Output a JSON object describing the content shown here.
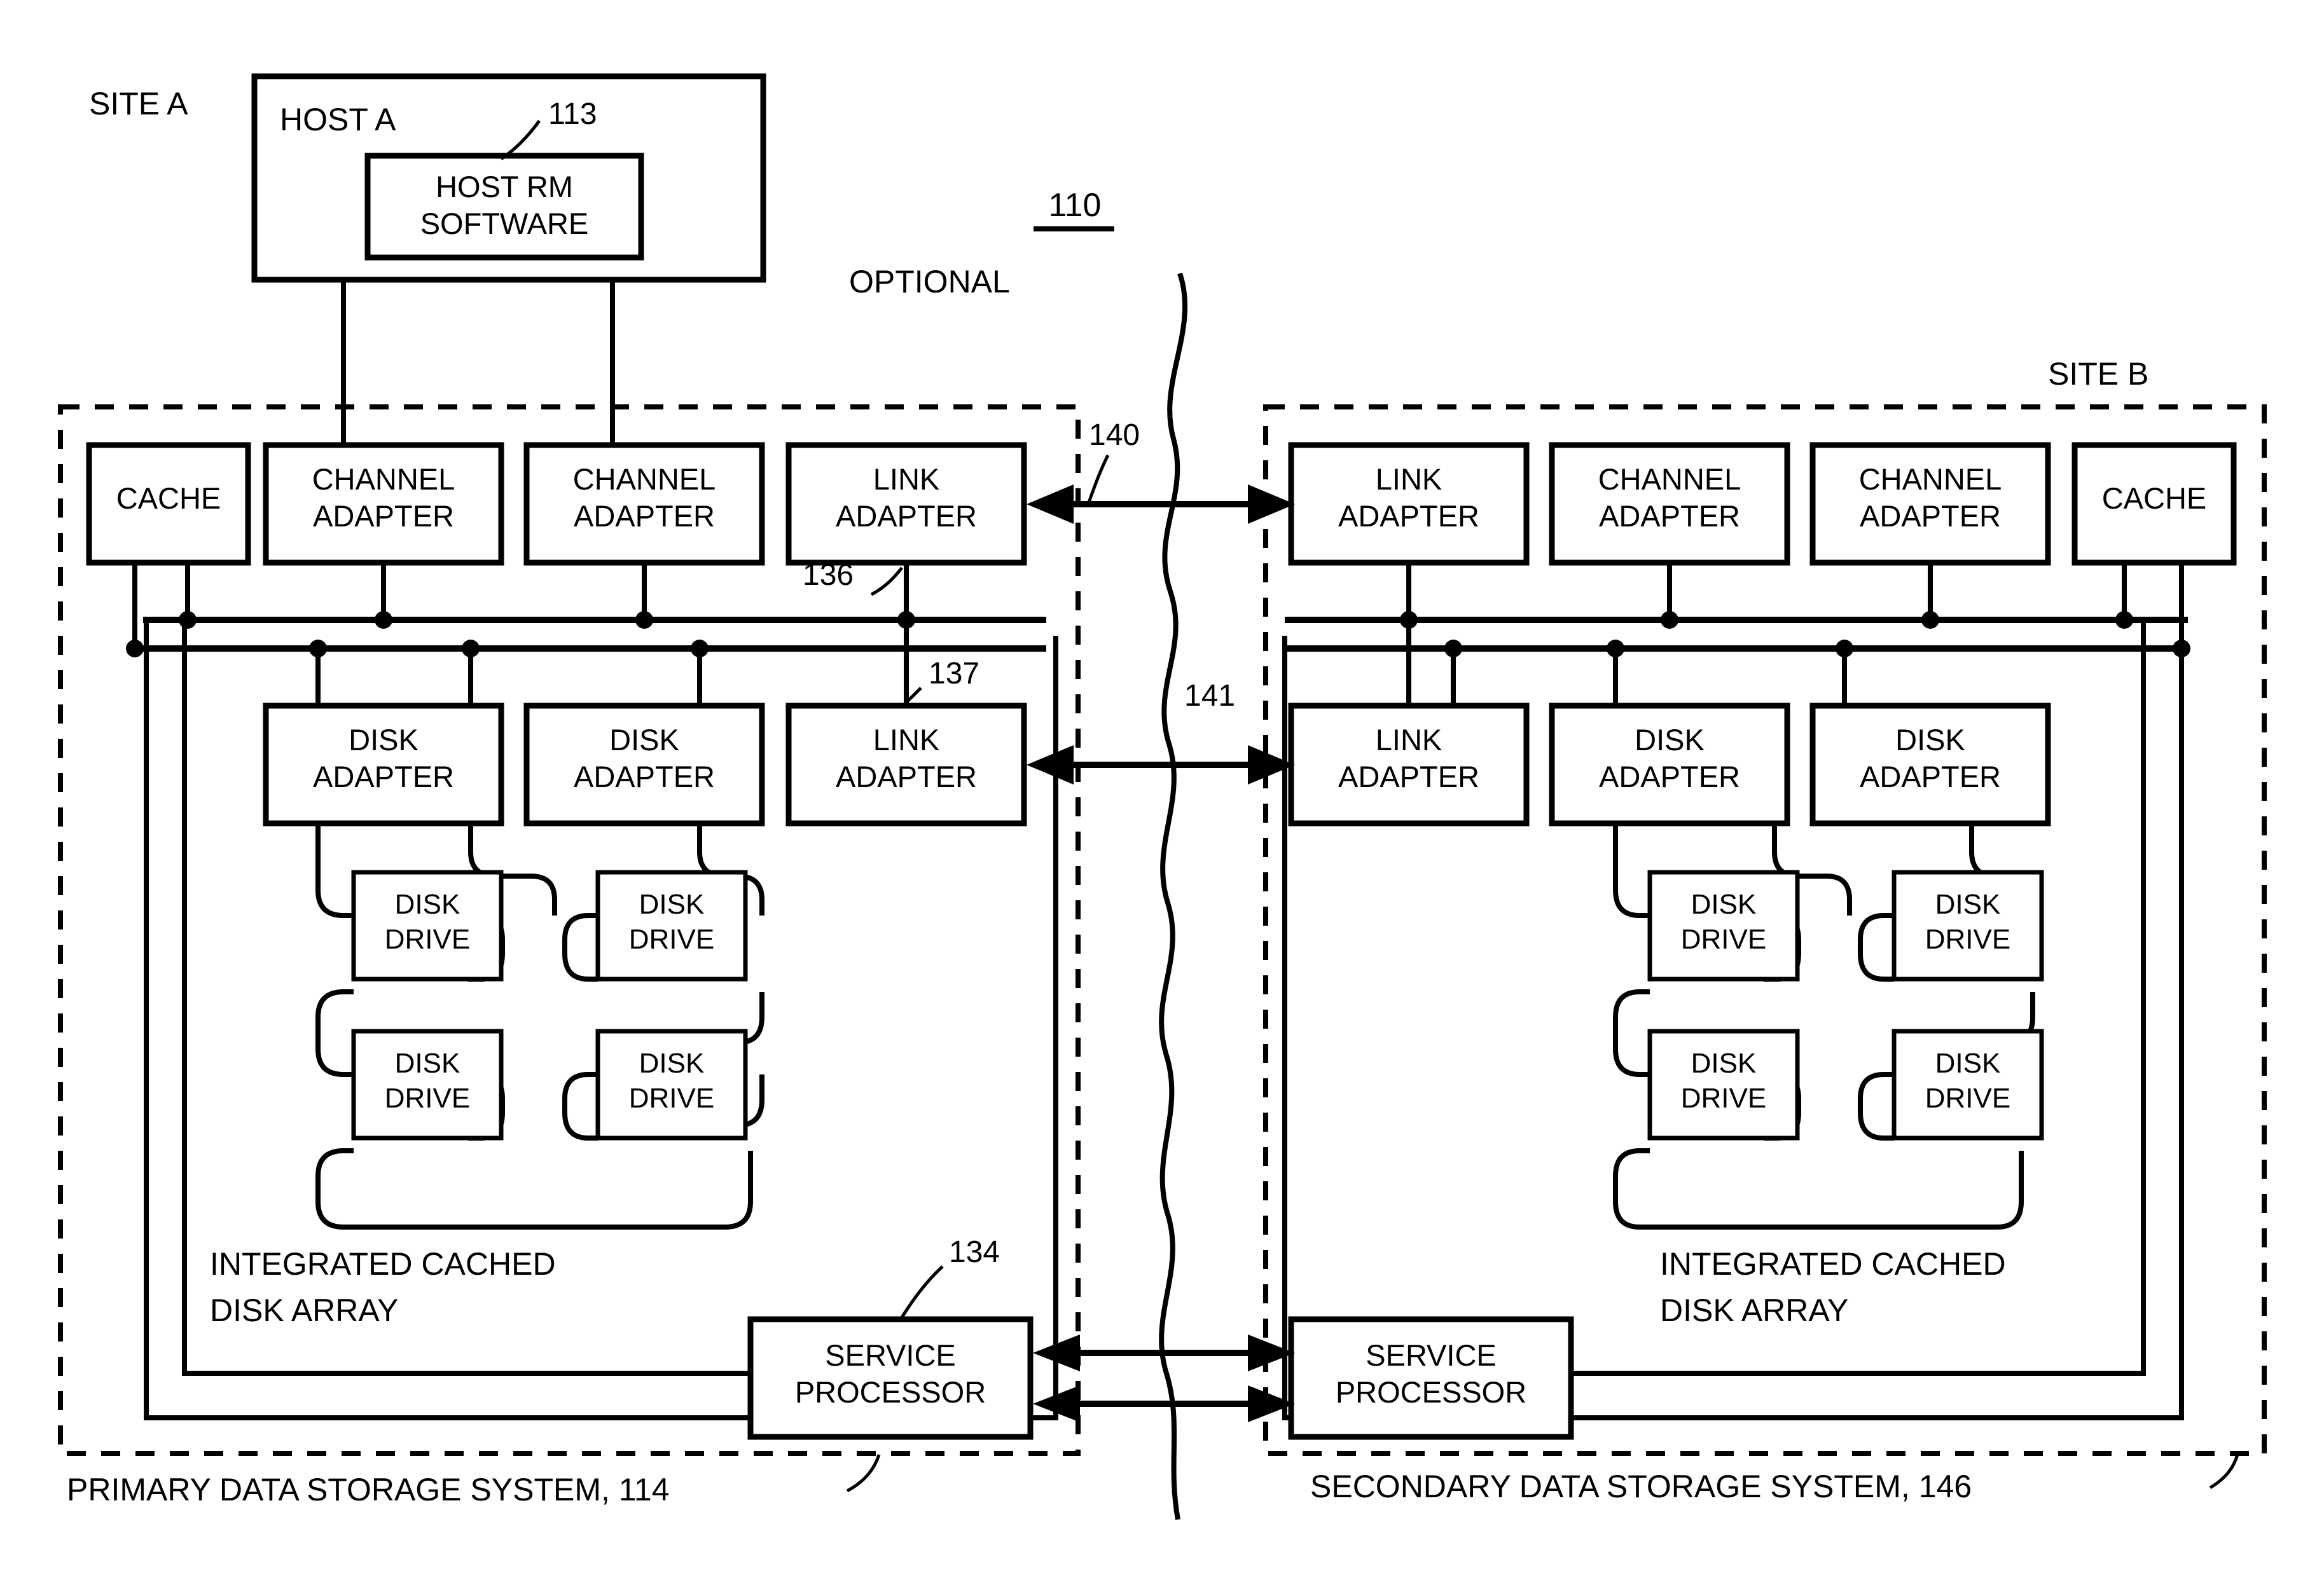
{
  "figure": {
    "number": "110",
    "optional_label": "OPTIONAL"
  },
  "sites": {
    "a_label": "SITE A",
    "b_label": "SITE B"
  },
  "host": {
    "title": "HOST A",
    "ref": "113",
    "software_line1": "HOST RM",
    "software_line2": "SOFTWARE",
    "software_full": "HOST RM SOFTWARE"
  },
  "primary": {
    "caption": "PRIMARY DATA STORAGE SYSTEM, 114",
    "array_line1": "INTEGRATED CACHED",
    "array_line2": "DISK ARRAY",
    "top_row": [
      {
        "line1": "CACHE",
        "line2": ""
      },
      {
        "line1": "CHANNEL",
        "line2": "ADAPTER"
      },
      {
        "line1": "CHANNEL",
        "line2": "ADAPTER"
      },
      {
        "line1": "LINK",
        "line2": "ADAPTER"
      }
    ],
    "mid_row": [
      {
        "line1": "DISK",
        "line2": "ADAPTER"
      },
      {
        "line1": "DISK",
        "line2": "ADAPTER"
      },
      {
        "line1": "LINK",
        "line2": "ADAPTER"
      }
    ],
    "drives": [
      {
        "line1": "DISK",
        "line2": "DRIVE"
      },
      {
        "line1": "DISK",
        "line2": "DRIVE"
      },
      {
        "line1": "DISK",
        "line2": "DRIVE"
      },
      {
        "line1": "DISK",
        "line2": "DRIVE"
      }
    ],
    "service_processor": {
      "line1": "SERVICE",
      "line2": "PROCESSOR",
      "ref": "134"
    },
    "bus_upper_ref": "136",
    "bus_lower_ref": "137"
  },
  "secondary": {
    "caption": "SECONDARY DATA STORAGE SYSTEM, 146",
    "array_line1": "INTEGRATED CACHED",
    "array_line2": "DISK ARRAY",
    "top_row": [
      {
        "line1": "LINK",
        "line2": "ADAPTER"
      },
      {
        "line1": "CHANNEL",
        "line2": "ADAPTER"
      },
      {
        "line1": "CHANNEL",
        "line2": "ADAPTER"
      },
      {
        "line1": "CACHE",
        "line2": ""
      }
    ],
    "mid_row": [
      {
        "line1": "LINK",
        "line2": "ADAPTER"
      },
      {
        "line1": "DISK",
        "line2": "ADAPTER"
      },
      {
        "line1": "DISK",
        "line2": "ADAPTER"
      }
    ],
    "drives": [
      {
        "line1": "DISK",
        "line2": "DRIVE"
      },
      {
        "line1": "DISK",
        "line2": "DRIVE"
      },
      {
        "line1": "DISK",
        "line2": "DRIVE"
      },
      {
        "line1": "DISK",
        "line2": "DRIVE"
      }
    ],
    "service_processor": {
      "line1": "SERVICE",
      "line2": "PROCESSOR"
    }
  },
  "links": {
    "upper_ref": "140",
    "lower_ref": "141"
  },
  "colors": {
    "ink": "#000000",
    "paper": "#ffffff"
  }
}
